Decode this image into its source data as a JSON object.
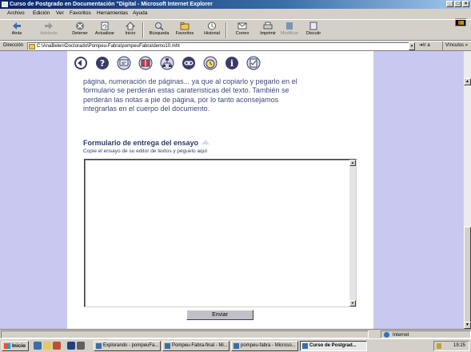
{
  "window": {
    "title": "Curso de Postgrado en Documentación \"Digital - Microsoft Internet Explorer"
  },
  "menu": [
    "Archivo",
    "Edición",
    "Ver",
    "Favoritos",
    "Herramientas",
    "Ayuda"
  ],
  "toolbar": {
    "back": "Atrás",
    "forward": "Adelante",
    "stop": "Detener",
    "refresh": "Actualizar",
    "home": "Inicio",
    "search": "Búsqueda",
    "favorites": "Favoritos",
    "history": "Historial",
    "mail": "Correo",
    "print": "Imprimir",
    "edit": "Modificar",
    "discuss": "Discutir"
  },
  "address": {
    "label": "Dirección",
    "url": "C:\\AnaBelen\\Doctorado\\Pompeu-Fabra\\pompeuFabra\\demo10.mht",
    "go": "Ir a",
    "links": "Vínculos »"
  },
  "page": {
    "nav_icons": [
      "back-arrow-icon",
      "help-icon",
      "chat-icon",
      "book-icon",
      "network-icon",
      "link-icon",
      "clock-icon",
      "info-icon",
      "check-icon"
    ],
    "body_text": "página, numeración de páginas... ya que al copiarlo y pegarlo en el formulario se perderán estas carateristicas del texto. También se perderán las notas a pie de página, por lo tanto aconsejamos integrarlas en el cuerpo del documento.",
    "form_title": "Formulario de entrega del ensayo",
    "form_subtitle": "Copie el ensayo de su editor de textos y péguelo aquí",
    "textarea_value": "",
    "submit_label": "Enviar"
  },
  "status": {
    "text": "",
    "zone": "Internet"
  },
  "taskbar": {
    "start": "Inicio",
    "tasks": [
      "Explorando - pompeuFa...",
      "Pompeu-Fabra-final - Mi...",
      "pompeu-fabra - Microso...",
      "Curso de Postgrad..."
    ],
    "clock": "19:25"
  },
  "colors": {
    "page_bg": "#c8c8f0",
    "text": "#3b4a7a",
    "titlebar": "#0a246a"
  }
}
